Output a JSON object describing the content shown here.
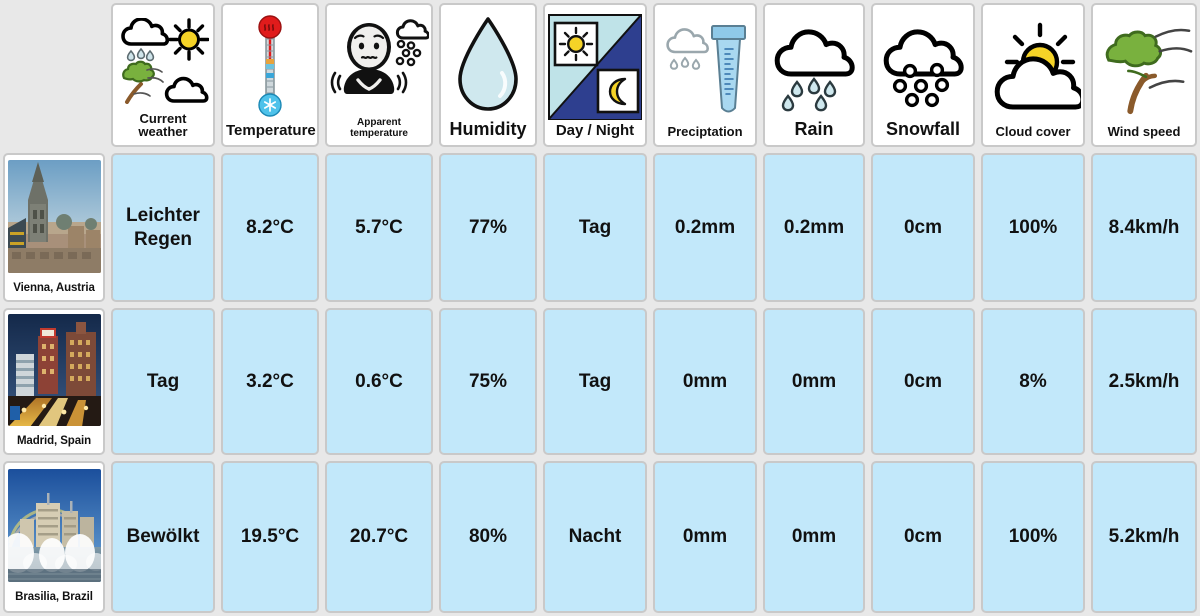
{
  "columns": [
    {
      "key": "city",
      "label": "",
      "icon": "",
      "size": ""
    },
    {
      "key": "current_weather",
      "label": "Current weather",
      "icon": "mixed-weather-icon",
      "size": "s13"
    },
    {
      "key": "temperature",
      "label": "Temperature",
      "icon": "thermometer-icon",
      "size": "s15"
    },
    {
      "key": "apparent_temperature",
      "label": "Apparent temperature",
      "icon": "shivering-person-icon",
      "size": "s10"
    },
    {
      "key": "humidity",
      "label": "Humidity",
      "icon": "water-drop-icon",
      "size": "s18"
    },
    {
      "key": "day_night",
      "label": "Day / Night",
      "icon": "day-night-icon",
      "size": "s15"
    },
    {
      "key": "precipitation",
      "label": "Preciptation",
      "icon": "rain-gauge-icon",
      "size": "s13"
    },
    {
      "key": "rain",
      "label": "Rain",
      "icon": "rain-cloud-icon",
      "size": "s18"
    },
    {
      "key": "snowfall",
      "label": "Snowfall",
      "icon": "snow-cloud-icon",
      "size": "s18"
    },
    {
      "key": "cloud_cover",
      "label": "Cloud cover",
      "icon": "sun-cloud-icon",
      "size": "s13"
    },
    {
      "key": "wind_speed",
      "label": "Wind speed",
      "icon": "windy-tree-icon",
      "size": "s13"
    }
  ],
  "rows": [
    {
      "city": "Vienna, Austria",
      "photo": "vienna-cathedral-cityscape",
      "current_weather": "Leichter Regen",
      "temperature": "8.2°C",
      "apparent_temperature": "5.7°C",
      "humidity": "77%",
      "day_night": "Tag",
      "precipitation": "0.2mm",
      "rain": "0.2mm",
      "snowfall": "0cm",
      "cloud_cover": "100%",
      "wind_speed": "8.4km/h"
    },
    {
      "city": "Madrid, Spain",
      "photo": "madrid-granvia-night",
      "current_weather": "Tag",
      "temperature": "3.2°C",
      "apparent_temperature": "0.6°C",
      "humidity": "75%",
      "day_night": "Tag",
      "precipitation": "0mm",
      "rain": "0mm",
      "snowfall": "0cm",
      "cloud_cover": "8%",
      "wind_speed": "2.5km/h"
    },
    {
      "city": "Brasilia, Brazil",
      "photo": "brasilia-fountain-rainbow",
      "current_weather": "Bewölkt",
      "temperature": "19.5°C",
      "apparent_temperature": "20.7°C",
      "humidity": "80%",
      "day_night": "Nacht",
      "precipitation": "0mm",
      "rain": "0mm",
      "snowfall": "0cm",
      "cloud_cover": "100%",
      "wind_speed": "5.2km/h"
    }
  ],
  "colors": {
    "page_background": "#e8e8e8",
    "value_cell": "#c2e8fa",
    "header_cell": "#ffffff",
    "cell_border": "#c9c9c9",
    "sun_yellow": "#f5d327",
    "night_blue": "#2e3f8f",
    "day_cyan": "#bfe3e8",
    "tree_green": "#79b13e",
    "drop_blue": "#bfe0e8"
  }
}
